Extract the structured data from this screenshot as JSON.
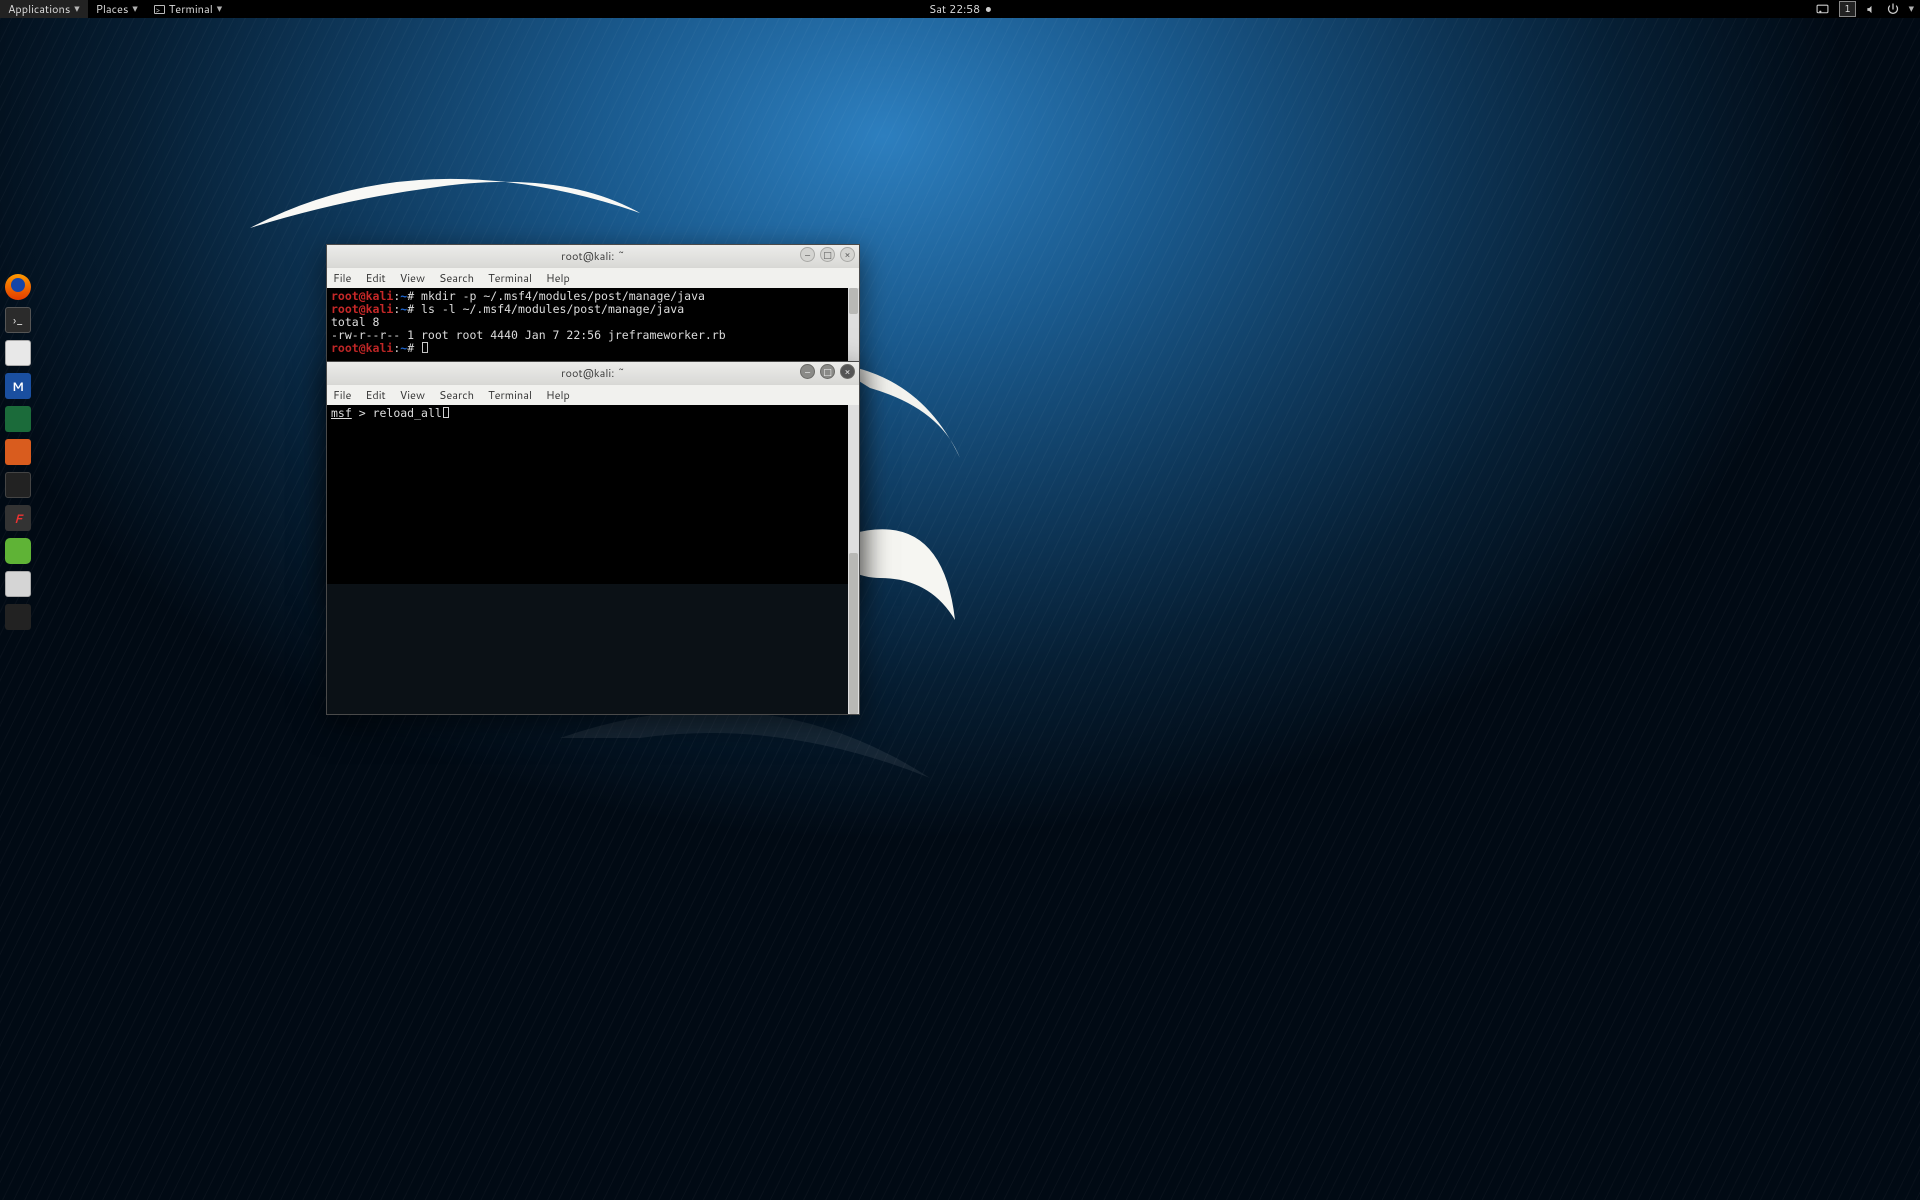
{
  "topbar": {
    "applications": "Applications",
    "places": "Places",
    "terminal": "Terminal",
    "clock": "Sat 22:58",
    "workspace": "1"
  },
  "dock": {
    "apps": [
      "firefox",
      "terminal",
      "files",
      "metasploit",
      "armitage",
      "burp",
      "maltego",
      "faraday",
      "notes",
      "settings",
      "show-applications"
    ]
  },
  "win1": {
    "title": "root@kali: ~",
    "menu": {
      "file": "File",
      "edit": "Edit",
      "view": "View",
      "search": "Search",
      "terminal": "Terminal",
      "help": "Help"
    },
    "prompt": {
      "user": "root@kali",
      "sep": ":",
      "path": "~",
      "sym": "# "
    },
    "cmd1": "mkdir -p ~/.msf4/modules/post/manage/java",
    "cmd2": "ls -l ~/.msf4/modules/post/manage/java",
    "out1": "total 8",
    "out2": "-rw-r--r-- 1 root root 4440 Jan  7 22:56 jreframeworker.rb"
  },
  "win2": {
    "title": "root@kali: ~",
    "menu": {
      "file": "File",
      "edit": "Edit",
      "view": "View",
      "search": "Search",
      "terminal": "Terminal",
      "help": "Help"
    },
    "msf_prompt_label": "msf",
    "msf_prompt_gt": " > ",
    "msf_cmd": "reload_all"
  }
}
